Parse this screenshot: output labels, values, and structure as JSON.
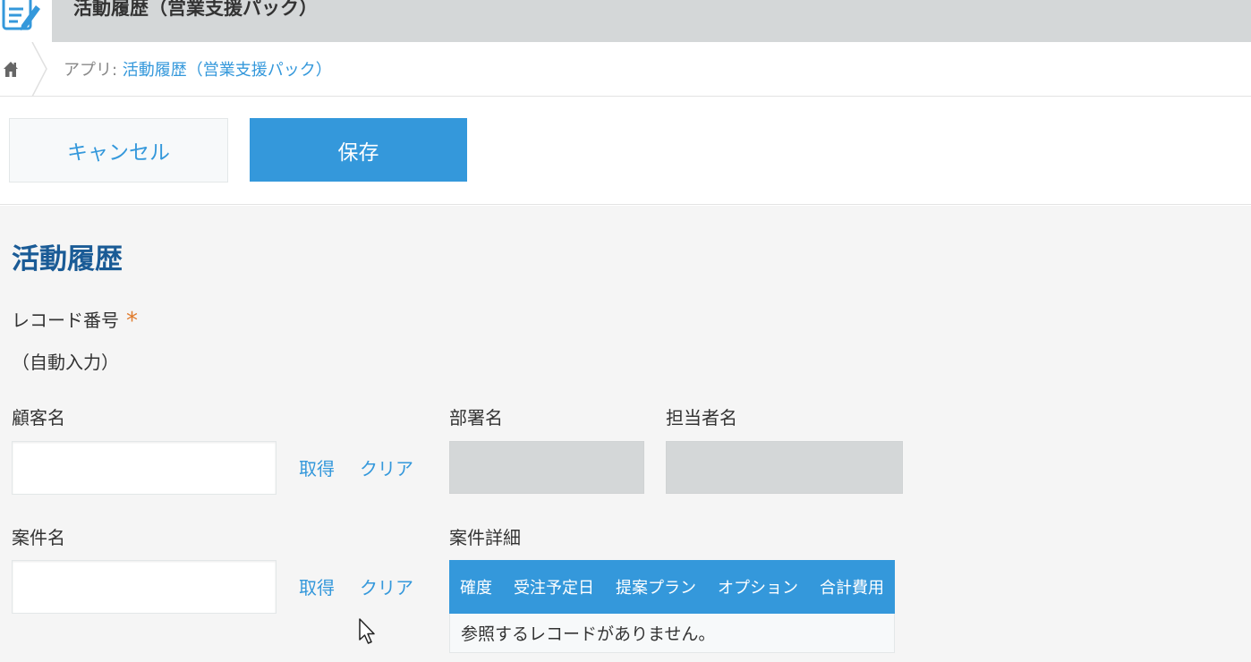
{
  "header": {
    "app_title": "活動履歴（営業支援パック）",
    "icon": "edit-note-icon"
  },
  "breadcrumb": {
    "home_icon": "home-icon",
    "prefix": "アプリ: ",
    "app_link": "活動履歴（営業支援パック）"
  },
  "actions": {
    "cancel_label": "キャンセル",
    "save_label": "保存"
  },
  "form": {
    "section_title": "活動履歴",
    "record_number": {
      "label": "レコード番号",
      "required_mark": "*",
      "value": "（自動入力）"
    },
    "customer": {
      "label": "顧客名",
      "value": "",
      "fetch_label": "取得",
      "clear_label": "クリア"
    },
    "department": {
      "label": "部署名"
    },
    "contact": {
      "label": "担当者名"
    },
    "deal": {
      "label": "案件名",
      "value": "",
      "fetch_label": "取得",
      "clear_label": "クリア"
    },
    "deal_details": {
      "label": "案件詳細",
      "columns": [
        "確度",
        "受注予定日",
        "提案プラン",
        "オプション",
        "合計費用"
      ],
      "empty_message": "参照するレコードがありません。"
    }
  },
  "colors": {
    "accent": "#3498db",
    "title": "#1a5b96",
    "required": "#e07b2c",
    "readonly": "#d4d7d8",
    "form_bg": "#f5f5f5"
  }
}
